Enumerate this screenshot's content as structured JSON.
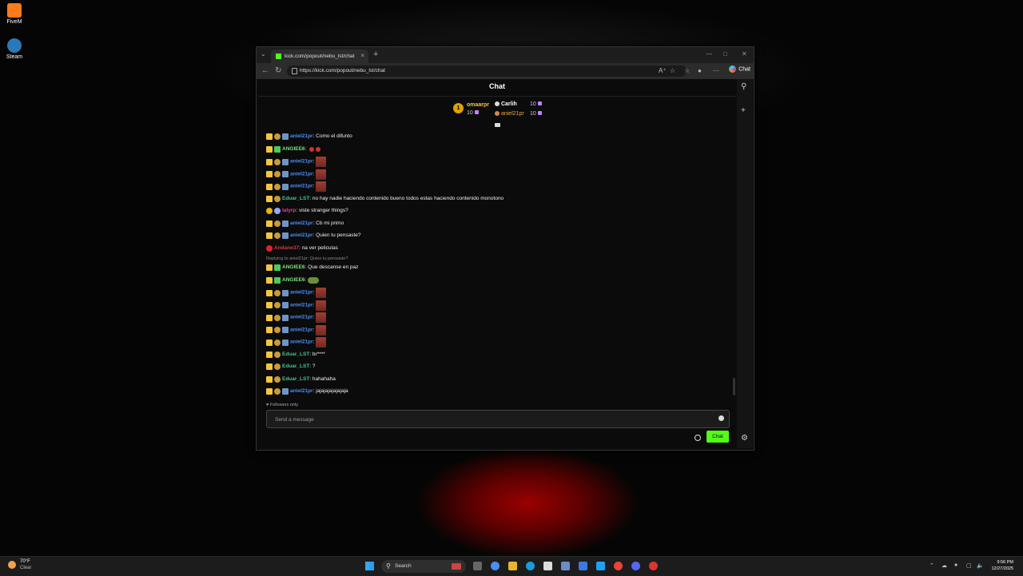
{
  "desktop": {
    "icons": [
      {
        "label": "FiveM",
        "color": "#ff7a1a"
      },
      {
        "label": "Steam",
        "color": "#2a7ab9"
      }
    ]
  },
  "browser": {
    "tab_title": "kick.com/popout/nebu_lst/chat",
    "url": "https://kick.com/popout/nebu_lst/chat",
    "copilot_label": "Chat"
  },
  "chat": {
    "title": "Chat",
    "leaders": [
      {
        "name": "omaarpr",
        "count": "10",
        "color": "#f5c542",
        "rank": "1"
      },
      {
        "name": "Carlih",
        "count": "10",
        "color": "#ffffff"
      },
      {
        "name": "aniel21pr",
        "count": "10",
        "color": "#f2a341"
      }
    ],
    "messages": [
      {
        "badges": [
          "crown",
          "sub",
          "bot"
        ],
        "user": "aniel21pr",
        "color": "#4b8ef5",
        "text": ": Como el difunto"
      },
      {
        "badges": [
          "crown",
          "gift"
        ],
        "user": "ANGIEE6",
        "color": "#7fe07f",
        "text": ": ",
        "emote": "xx"
      },
      {
        "badges": [
          "crown",
          "sub",
          "bot"
        ],
        "user": "aniel21pr",
        "color": "#4b8ef5",
        "text": ": ",
        "emote": "img"
      },
      {
        "badges": [
          "crown",
          "sub",
          "bot"
        ],
        "user": "aniel21pr",
        "color": "#4b8ef5",
        "text": ": ",
        "emote": "img"
      },
      {
        "badges": [
          "crown",
          "sub",
          "bot"
        ],
        "user": "aniel21pr",
        "color": "#4b8ef5",
        "text": ": ",
        "emote": "img"
      },
      {
        "badges": [
          "crown",
          "sub"
        ],
        "user": "Eduar_LST",
        "color": "#41c48f",
        "text": ": no hay nadie haciendo contenido bueno todos estas haciendo contenido monotono"
      },
      {
        "badges": [
          "og",
          "gem"
        ],
        "user": "lalyrp",
        "color": "#e0428f",
        "text": ": viste stranger things?"
      },
      {
        "badges": [
          "crown",
          "sub",
          "bot"
        ],
        "user": "aniel21pr",
        "color": "#4b8ef5",
        "text": ": Cb mi primo"
      },
      {
        "badges": [
          "crown",
          "sub",
          "bot"
        ],
        "user": "aniel21pr",
        "color": "#4b8ef5",
        "text": ": Quien tu pensaste?"
      },
      {
        "badges": [
          "red"
        ],
        "user": "Andane37",
        "color": "#d63a3a",
        "text": ": na ver peliculas"
      },
      {
        "reply": "Replying to aniel21pr: Quien tu pensaste?",
        "badges": [
          "crown",
          "gift"
        ],
        "user": "ANGIEE6",
        "color": "#7fe07f",
        "text": ": Que descanse en paz"
      },
      {
        "badges": [
          "crown",
          "gift"
        ],
        "user": "ANGIEE6",
        "color": "#7fe07f",
        "text": ": ",
        "emote": "frog"
      },
      {
        "badges": [
          "crown",
          "sub",
          "bot"
        ],
        "user": "aniel21pr",
        "color": "#4b8ef5",
        "text": ": ",
        "emote": "img"
      },
      {
        "badges": [
          "crown",
          "sub",
          "bot"
        ],
        "user": "aniel21pr",
        "color": "#4b8ef5",
        "text": ": ",
        "emote": "img"
      },
      {
        "badges": [
          "crown",
          "sub",
          "bot"
        ],
        "user": "aniel21pr",
        "color": "#4b8ef5",
        "text": ": ",
        "emote": "img"
      },
      {
        "badges": [
          "crown",
          "sub",
          "bot"
        ],
        "user": "aniel21pr",
        "color": "#4b8ef5",
        "text": ": ",
        "emote": "img"
      },
      {
        "badges": [
          "crown",
          "sub",
          "bot"
        ],
        "user": "aniel21pr",
        "color": "#4b8ef5",
        "text": ": ",
        "emote": "img"
      },
      {
        "badges": [
          "crown",
          "sub"
        ],
        "user": "Eduar_LST",
        "color": "#41c48f",
        "text": ": br****"
      },
      {
        "badges": [
          "crown",
          "sub"
        ],
        "user": "Eduar_LST",
        "color": "#41c48f",
        "text": ": ?"
      },
      {
        "badges": [
          "crown",
          "sub"
        ],
        "user": "Eduar_LST",
        "color": "#41c48f",
        "text": ": hahahaha"
      },
      {
        "badges": [
          "crown",
          "sub",
          "bot"
        ],
        "user": "aniel21pr",
        "color": "#4b8ef5",
        "text": ": jajajajajajajaja"
      }
    ],
    "followers_only": "Followers only",
    "input_placeholder": "Send a message",
    "send_label": "Chat",
    "accent": "#53fc18"
  },
  "taskbar": {
    "weather_temp": "70°F",
    "weather_cond": "Clear",
    "search_label": "Search",
    "time": "9:56 PM",
    "date": "12/27/2025"
  }
}
